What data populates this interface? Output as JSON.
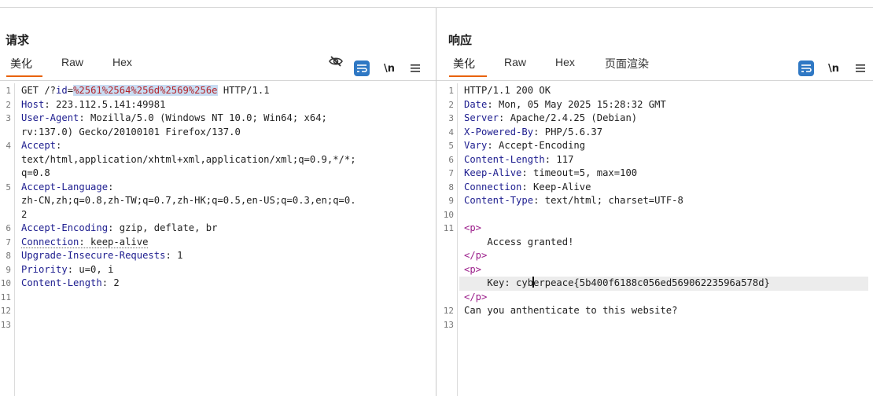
{
  "layout_buttons": [
    "split-vertical",
    "split-horizontal",
    "single"
  ],
  "request": {
    "title": "请求",
    "tabs": [
      "美化",
      "Raw",
      "Hex"
    ],
    "active_tab": "美化",
    "line_numbers": [
      "1",
      "2",
      "3",
      "4",
      "5",
      "6",
      "7",
      "8",
      "9",
      "10",
      "11",
      "12",
      "13"
    ],
    "lines": {
      "l1_pre": "GET /?",
      "l1_pname": "id",
      "l1_eq": "=",
      "l1_pval": "%2561%2564%256d%2569%256e",
      "l1_post": " HTTP/1.1",
      "host_name": "Host",
      "host_val": ": 223.112.5.141:49981",
      "ua_name": "User-Agent",
      "ua_val": ": Mozilla/5.0 (Windows NT 10.0; Win64; x64;",
      "ua_cont": "rv:137.0) Gecko/20100101 Firefox/137.0",
      "accept_name": "Accept",
      "accept_colon": ":",
      "accept_val1": "text/html,application/xhtml+xml,application/xml;q=0.9,*/*;",
      "accept_val2": "q=0.8",
      "al_name": "Accept-Language",
      "al_colon": ":",
      "al_val1": "zh-CN,zh;q=0.8,zh-TW;q=0.7,zh-HK;q=0.5,en-US;q=0.3,en;q=0.",
      "al_val2": "2",
      "ae_name": "Accept-Encoding",
      "ae_val": ": gzip, deflate, br",
      "conn_name": "Connection",
      "conn_val": ": keep-alive",
      "uir_name": "Upgrade-Insecure-Requests",
      "uir_val": ": 1",
      "prio_name": "Priority",
      "prio_val": ": u=0, i",
      "cl_name": "Content-Length",
      "cl_val": ": 2"
    }
  },
  "response": {
    "title": "响应",
    "tabs": [
      "美化",
      "Raw",
      "Hex",
      "页面渲染"
    ],
    "active_tab": "美化",
    "line_numbers": [
      "1",
      "2",
      "3",
      "4",
      "5",
      "6",
      "7",
      "8",
      "9",
      "10",
      "11",
      "12",
      "13"
    ],
    "lines": {
      "status": "HTTP/1.1 200 OK",
      "date_name": "Date",
      "date_val": ": Mon, 05 May 2025 15:28:32 GMT",
      "server_name": "Server",
      "server_val": ": Apache/2.4.25 (Debian)",
      "xpb_name": "X-Powered-By",
      "xpb_val": ": PHP/5.6.37",
      "vary_name": "Vary",
      "vary_val": ": Accept-Encoding",
      "cl_name": "Content-Length",
      "cl_val": ": 117",
      "ka_name": "Keep-Alive",
      "ka_val": ": timeout=5, max=100",
      "conn_name": "Connection",
      "conn_val": ": Keep-Alive",
      "ct_name": "Content-Type",
      "ct_val": ": text/html; charset=UTF-8",
      "p_open": "<p>",
      "access": "    Access granted!",
      "p_close": "</p>",
      "p_open2": "<p>",
      "key_pre": "    Key: cyb",
      "key_post": "erpeace{5b400f6188c056ed56906223596a578d}",
      "p_close2": "</p>",
      "last": "Can you anthenticate to this website?"
    }
  },
  "colors": {
    "accent": "#e8620c",
    "button_blue": "#2f78c4",
    "header_name": "#1d1d8f",
    "param_value": "#b3262b",
    "tag": "#9b1d8a"
  }
}
